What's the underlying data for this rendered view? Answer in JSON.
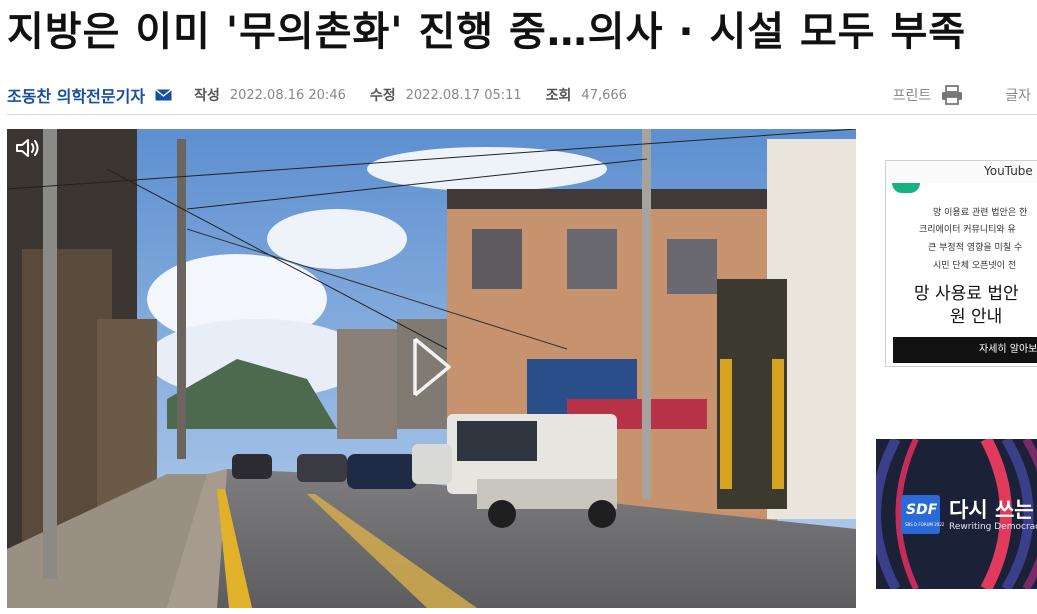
{
  "article": {
    "headline": "지방은 이미 '무의촌화' 진행 중…의사 · 시설 모두 부족",
    "reporter": "조동찬 의학전문기자",
    "created_label": "작성",
    "created_value": "2022.08.16 20:46",
    "modified_label": "수정",
    "modified_value": "2022.08.17 05:11",
    "views_label": "조회",
    "views_value": "47,666"
  },
  "tools": {
    "print_label": "프린트",
    "font_label": "글자"
  },
  "icons": {
    "mail": "envelope-icon",
    "print": "printer-icon",
    "mute": "speaker-icon",
    "play": "play-icon"
  },
  "ad_youtube": {
    "source": "YouTube",
    "lines": [
      "망 이용료 관련 법안은 한",
      "크리에이터 커뮤니티와 유",
      "큰 부정적 영향을 미칠 수",
      "시민 단체 오픈넷이 전"
    ],
    "title_lines": [
      "망 사용료 법안",
      "원 안내"
    ],
    "button_label": "자세히 알아보기"
  },
  "ad_sdf": {
    "logo_text": "SDF",
    "logo_sub": "SBS D FORUM 2022",
    "title": "다시 쓰는",
    "subtitle": "Rewriting Democracy"
  },
  "colors": {
    "reporter": "#1a4ea1",
    "ad_accent": "#17b183",
    "sdf_bg": "#1b2238",
    "sdf_logo": "#2a6bd8"
  }
}
